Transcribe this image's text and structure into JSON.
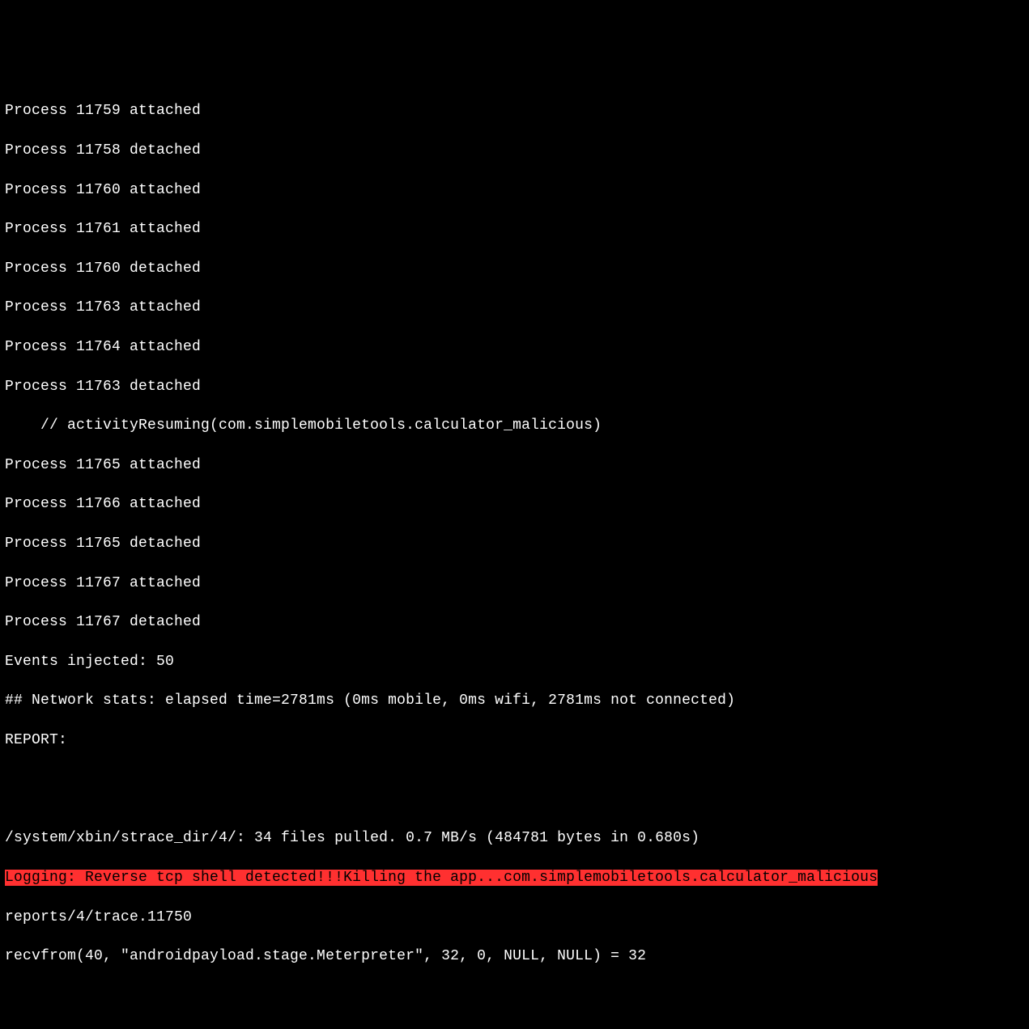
{
  "terminal": {
    "lines": [
      "Process 11759 attached",
      "Process 11758 detached",
      "Process 11760 attached",
      "Process 11761 attached",
      "Process 11760 detached",
      "Process 11763 attached",
      "Process 11764 attached",
      "Process 11763 detached",
      "    // activityResuming(com.simplemobiletools.calculator_malicious)",
      "Process 11765 attached",
      "Process 11766 attached",
      "Process 11765 detached",
      "Process 11767 attached",
      "Process 11767 detached",
      "Events injected: 50",
      "## Network stats: elapsed time=2781ms (0ms mobile, 0ms wifi, 2781ms not connected)",
      "REPORT:",
      "",
      "",
      "",
      "/system/xbin/strace_dir/4/: 34 files pulled. 0.7 MB/s (484781 bytes in 0.680s)"
    ],
    "highlight": "Logging: Reverse tcp shell detected!!!Killing the app...com.simplemobiletools.calculator_malicious",
    "tail": [
      "reports/4/trace.11750",
      "recvfrom(40, \"androidpayload.stage.Meterpreter\", 32, 0, NULL, NULL) = 32"
    ]
  }
}
